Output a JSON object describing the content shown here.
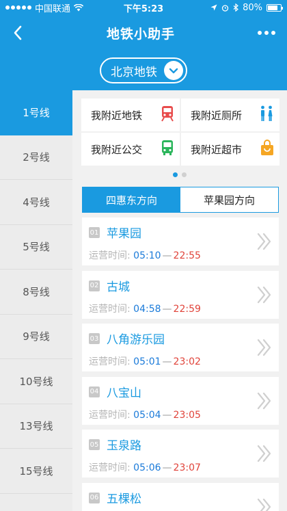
{
  "status": {
    "carrier": "中国联通",
    "time": "下午5:23",
    "battery_text": "80%",
    "battery_level": 0.8,
    "icons": [
      "signal-dots-icon",
      "wifi-icon",
      "location-arrow-icon",
      "alarm-icon",
      "bluetooth-icon",
      "battery-icon"
    ]
  },
  "nav": {
    "title": "地铁小助手",
    "back_icon": "chevron-left-icon",
    "more_icon": "more-dots-icon"
  },
  "city": {
    "label": "北京地铁",
    "icon": "chevron-down-circle-icon"
  },
  "sidebar": {
    "active_index": 0,
    "items": [
      "1号线",
      "2号线",
      "4号线",
      "5号线",
      "8号线",
      "9号线",
      "10号线",
      "13号线",
      "15号线"
    ]
  },
  "nearby": [
    {
      "label": "我附近地铁",
      "icon": "train-icon",
      "color": "#e84c4c"
    },
    {
      "label": "我附近厕所",
      "icon": "restroom-icon",
      "color": "#1a9ae0"
    },
    {
      "label": "我附近公交",
      "icon": "bus-icon",
      "color": "#2bb55b"
    },
    {
      "label": "我附近超市",
      "icon": "shopping-bag-icon",
      "color": "#f5a623"
    }
  ],
  "pager": {
    "count": 2,
    "active": 0
  },
  "directions": {
    "active_index": 0,
    "tabs": [
      "四惠东方向",
      "苹果园方向"
    ]
  },
  "stations": {
    "time_label": "运营时间:",
    "separator": "—",
    "items": [
      {
        "num": "01",
        "name": "苹果园",
        "open": "05:10",
        "close": "22:55"
      },
      {
        "num": "02",
        "name": "古城",
        "open": "04:58",
        "close": "22:59"
      },
      {
        "num": "03",
        "name": "八角游乐园",
        "open": "05:01",
        "close": "23:02"
      },
      {
        "num": "04",
        "name": "八宝山",
        "open": "05:04",
        "close": "23:05"
      },
      {
        "num": "05",
        "name": "玉泉路",
        "open": "05:06",
        "close": "23:07"
      },
      {
        "num": "06",
        "name": "五棵松",
        "open": "",
        "close": ""
      }
    ]
  },
  "colors": {
    "primary": "#1a9ae0",
    "open_time": "#1a7ad9",
    "close_time": "#e0433a"
  }
}
